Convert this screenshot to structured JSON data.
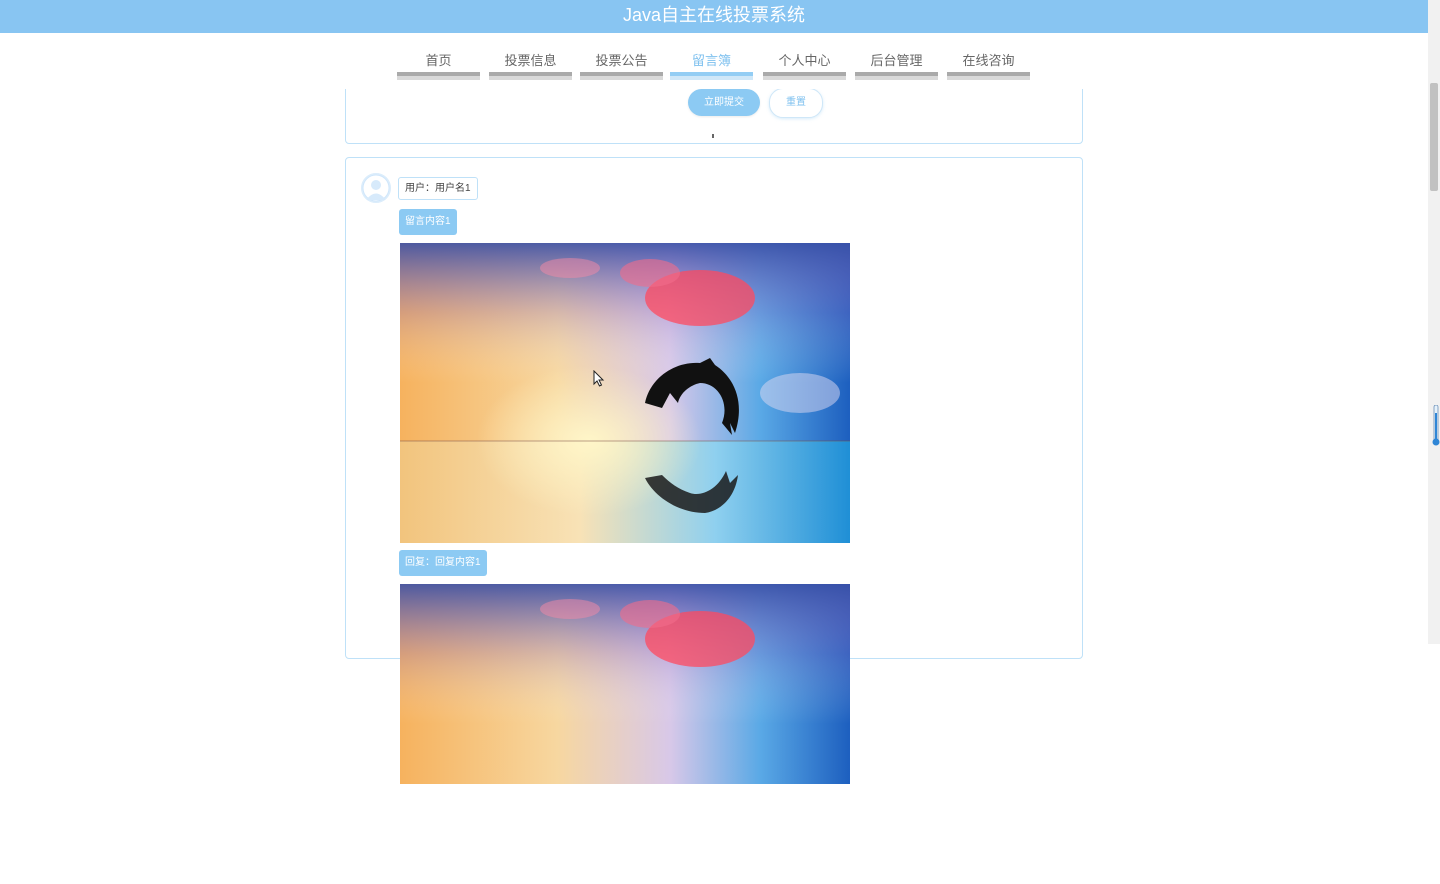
{
  "header": {
    "title": "Java自主在线投票系统"
  },
  "nav": {
    "items": [
      {
        "label": "首页",
        "active": false
      },
      {
        "label": "投票信息",
        "active": false
      },
      {
        "label": "投票公告",
        "active": false
      },
      {
        "label": "留言簿",
        "active": true
      },
      {
        "label": "个人中心",
        "active": false
      },
      {
        "label": "后台管理",
        "active": false
      },
      {
        "label": "在线咨询",
        "active": false
      }
    ]
  },
  "form": {
    "submit_label": "立即提交",
    "reset_label": "重置"
  },
  "messages": [
    {
      "user_label": "用户：用户名1",
      "content": "留言内容1",
      "reply": "回复：回复内容1"
    }
  ],
  "colors": {
    "accent": "#88c5f2",
    "border": "#bfe1f8"
  }
}
